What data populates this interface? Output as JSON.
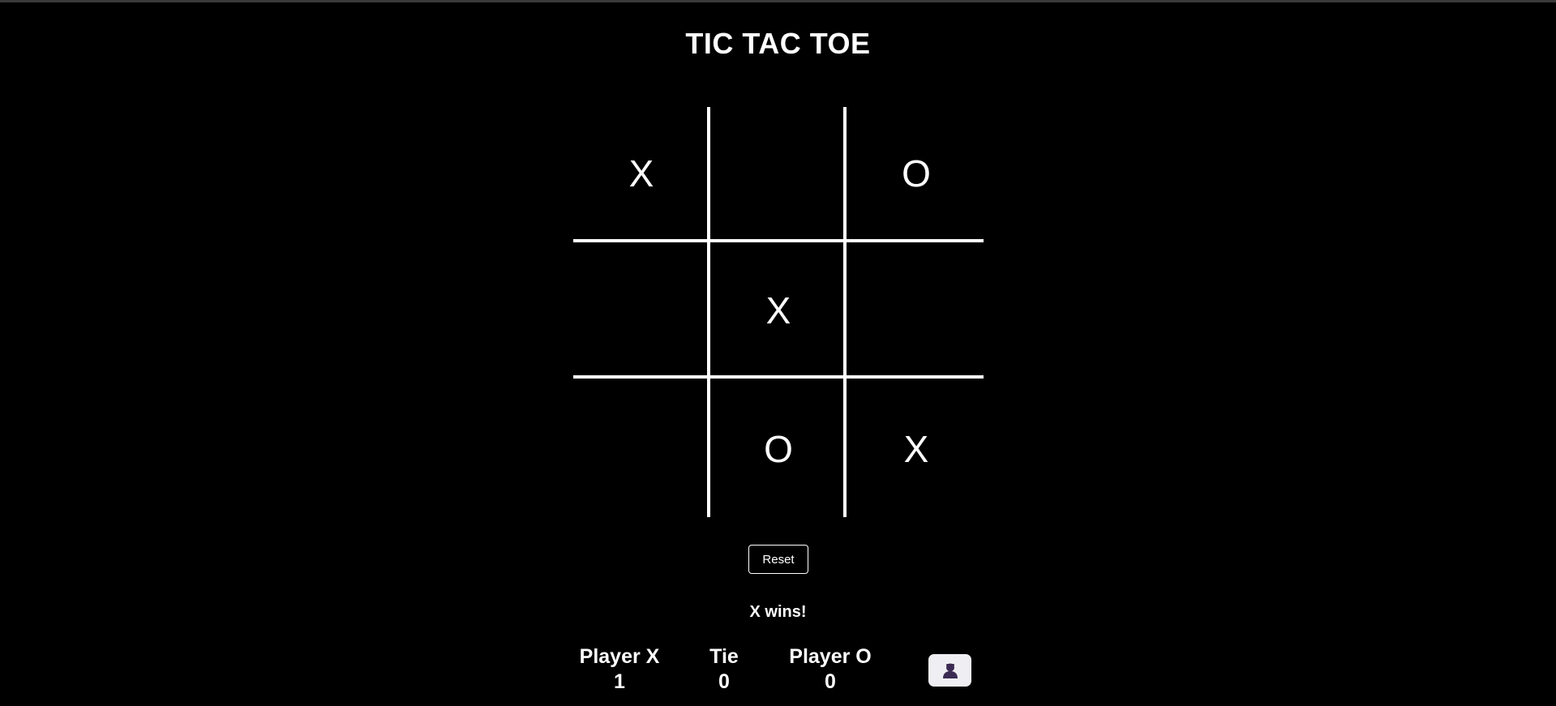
{
  "title": "TIC TAC TOE",
  "board": {
    "cells": [
      "X",
      "",
      "O",
      "",
      "X",
      "",
      "",
      "O",
      "X"
    ]
  },
  "reset_label": "Reset",
  "status": "X wins!",
  "scores": {
    "player_x": {
      "label": "Player X",
      "value": "1"
    },
    "tie": {
      "label": "Tie",
      "value": "0"
    },
    "player_o": {
      "label": "Player O",
      "value": "0"
    }
  },
  "icons": {
    "avatar": "user-icon"
  },
  "colors": {
    "background": "#000000",
    "foreground": "#ffffff",
    "avatar_button_bg": "#efeef2",
    "avatar_icon": "#3b2a52"
  }
}
